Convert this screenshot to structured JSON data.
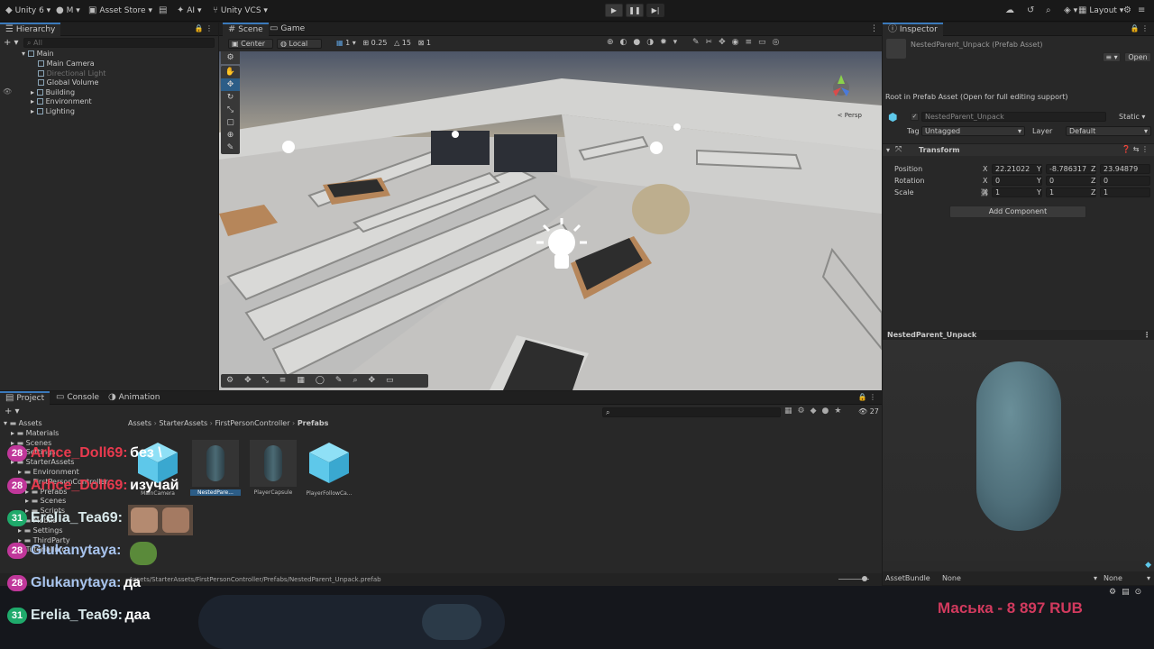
{
  "toolbar": {
    "unity_label": "Unity 6",
    "account_label": "M",
    "asset_store_label": "Asset Store",
    "ai_label": "AI",
    "vcs_label": "Unity VCS",
    "layout_label": "Layout"
  },
  "hierarchy": {
    "tab_label": "Hierarchy",
    "search_placeholder": "All",
    "scene_name": "Main",
    "items": [
      {
        "label": "Main Camera",
        "dim": false
      },
      {
        "label": "Directional Light",
        "dim": true
      },
      {
        "label": "Global Volume",
        "dim": false
      },
      {
        "label": "Building",
        "dim": false
      },
      {
        "label": "Environment",
        "dim": false
      },
      {
        "label": "Lighting",
        "dim": false
      }
    ]
  },
  "scene": {
    "tabs": {
      "scene": "Scene",
      "game": "Game"
    },
    "pivot_label": "Center",
    "space_label": "Local",
    "grid_value": "1",
    "snap_value": "0.25",
    "rotate_snap": "15",
    "scale_snap": "1",
    "persp_label": "< Persp"
  },
  "inspector": {
    "tab_label": "Inspector",
    "asset_title": "NestedParent_Unpack (Prefab Asset)",
    "open_label": "Open",
    "root_note": "Root in Prefab Asset (Open for full editing support)",
    "object_name": "NestedParent_Unpack",
    "static_label": "Static",
    "tag_label": "Tag",
    "tag_value": "Untagged",
    "layer_label": "Layer",
    "layer_value": "Default",
    "transform_label": "Transform",
    "position_label": "Position",
    "rotation_label": "Rotation",
    "scale_label": "Scale",
    "position": {
      "x": "22.21022",
      "y": "-8.786317",
      "z": "23.94879"
    },
    "rotation": {
      "x": "0",
      "y": "0",
      "z": "0"
    },
    "scale": {
      "x": "1",
      "y": "1",
      "z": "1"
    },
    "add_component_label": "Add Component",
    "preview_title": "NestedParent_Unpack",
    "assetbundle_label": "AssetBundle",
    "assetbundle_value": "None",
    "variant_value": "None"
  },
  "project": {
    "tabs": {
      "project": "Project",
      "console": "Console",
      "animation": "Animation"
    },
    "breadcrumb": [
      "Assets",
      "StarterAssets",
      "FirstPersonController",
      "Prefabs"
    ],
    "count_label": "27",
    "tree": [
      {
        "label": "Assets",
        "indent": 0
      },
      {
        "label": "Materials",
        "indent": 1
      },
      {
        "label": "Scenes",
        "indent": 1
      },
      {
        "label": "Settings",
        "indent": 1
      },
      {
        "label": "StarterAssets",
        "indent": 1
      },
      {
        "label": "Environment",
        "indent": 2
      },
      {
        "label": "FirstPersonController",
        "indent": 2
      },
      {
        "label": "Prefabs",
        "indent": 3
      },
      {
        "label": "Scenes",
        "indent": 3
      },
      {
        "label": "Scripts",
        "indent": 3
      },
      {
        "label": "Mobile",
        "indent": 2
      },
      {
        "label": "Settings",
        "indent": 2
      },
      {
        "label": "ThirdParty",
        "indent": 2
      },
      {
        "label": "TutorialInfo",
        "indent": 1
      }
    ],
    "assets": [
      {
        "label": "MainCamera",
        "kind": "cube"
      },
      {
        "label": "NestedPare...",
        "kind": "capsule"
      },
      {
        "label": "PlayerCapsule",
        "kind": "capsule"
      },
      {
        "label": "PlayerFollowCa...",
        "kind": "cube"
      }
    ],
    "status_path": "Assets/StarterAssets/FirstPersonController/Prefabs/NestedParent_Unpack.prefab"
  },
  "chat": [
    {
      "badge": "28",
      "badge_color": "#c0379a",
      "name": "Arhce_Doll69:",
      "name_color": "#e83a4e",
      "msg": "без \\"
    },
    {
      "badge": "28",
      "badge_color": "#c0379a",
      "name": "Arhce_Doll69:",
      "name_color": "#e83a4e",
      "msg": "изучай"
    },
    {
      "badge": "31",
      "badge_color": "#1faa6b",
      "name": "Erelia_Tea69:",
      "name_color": "#d8e8ea",
      "msg": ""
    },
    {
      "badge": "28",
      "badge_color": "#c0379a",
      "name": "Glukanytaya:",
      "name_color": "#a8c4ee",
      "msg": ""
    },
    {
      "badge": "28",
      "badge_color": "#c0379a",
      "name": "Glukanytaya:",
      "name_color": "#a8c4ee",
      "msg": "да"
    },
    {
      "badge": "31",
      "badge_color": "#1faa6b",
      "name": "Erelia_Tea69:",
      "name_color": "#d8e8ea",
      "msg": "даа"
    }
  ],
  "donation": {
    "text": "Маська - 8 897 RUB",
    "color": "#d23a5e"
  },
  "colors": {
    "accent": "#3a79bb",
    "capsule": "#4f6f7a",
    "cube_icon": "#5ec8ea"
  }
}
